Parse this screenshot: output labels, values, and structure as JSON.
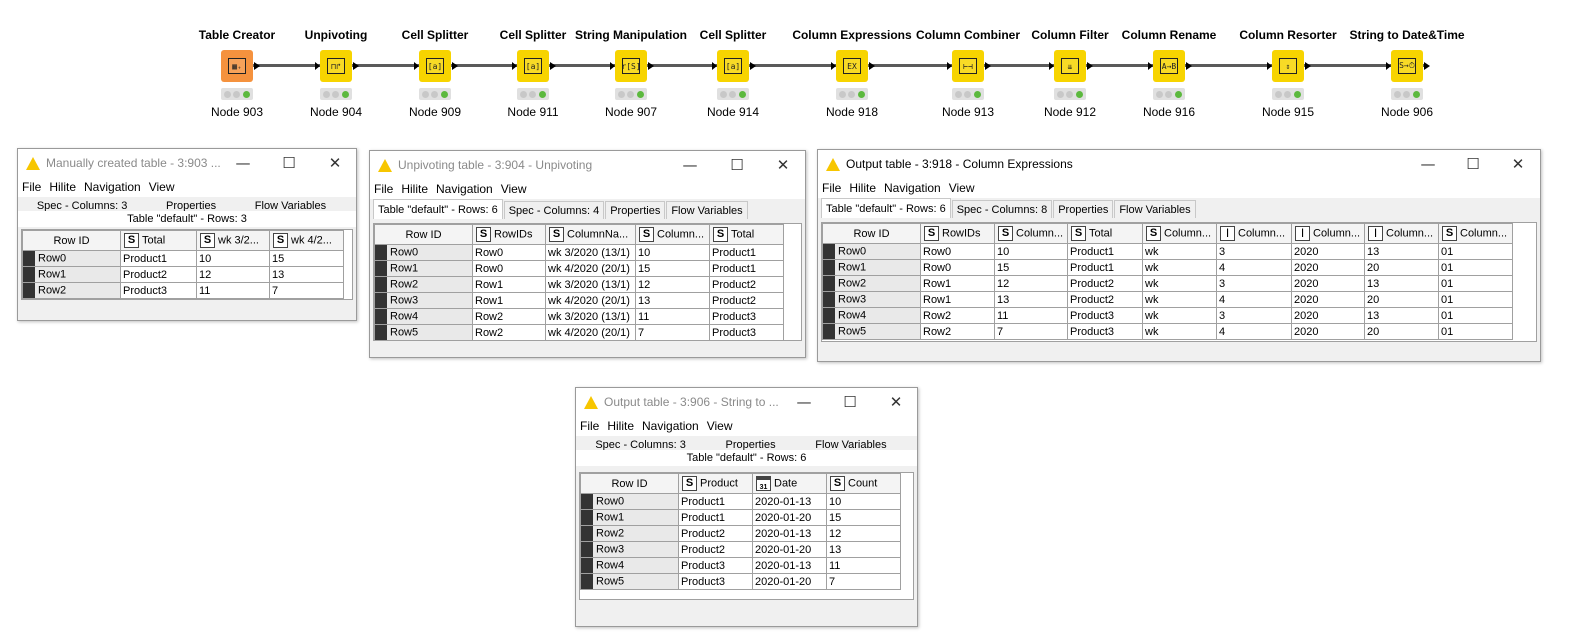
{
  "workflow": {
    "nodes": [
      {
        "name": "Table Creator",
        "label": "Node 903",
        "icon": "table-creator-icon",
        "glyph": "▦₊",
        "kind": "source"
      },
      {
        "name": "Unpivoting",
        "label": "Node 904",
        "icon": "unpivoting-icon",
        "glyph": "⊓↱",
        "kind": "manipulator"
      },
      {
        "name": "Cell Splitter",
        "label": "Node 909",
        "icon": "cell-splitter-icon",
        "glyph": "[a]",
        "kind": "manipulator"
      },
      {
        "name": "Cell Splitter",
        "label": "Node 911",
        "icon": "cell-splitter-icon",
        "glyph": "[a]",
        "kind": "manipulator"
      },
      {
        "name": "String Manipulation",
        "label": "Node 907",
        "icon": "string-manipulation-icon",
        "glyph": "r[S]",
        "kind": "manipulator"
      },
      {
        "name": "Cell Splitter",
        "label": "Node 914",
        "icon": "cell-splitter-icon",
        "glyph": "[a]",
        "kind": "manipulator"
      },
      {
        "name": "Column Expressions",
        "label": "Node 918",
        "icon": "column-expressions-icon",
        "glyph": "EX",
        "kind": "manipulator"
      },
      {
        "name": "Column Combiner",
        "label": "Node 913",
        "icon": "column-combiner-icon",
        "glyph": "⊢⊣",
        "kind": "manipulator"
      },
      {
        "name": "Column Filter",
        "label": "Node 912",
        "icon": "column-filter-icon",
        "glyph": "⇊",
        "kind": "manipulator"
      },
      {
        "name": "Column Rename",
        "label": "Node 916",
        "icon": "column-rename-icon",
        "glyph": "A→B",
        "kind": "manipulator"
      },
      {
        "name": "Column Resorter",
        "label": "Node 915",
        "icon": "column-resorter-icon",
        "glyph": "⇕",
        "kind": "manipulator"
      },
      {
        "name": "String to Date&Time",
        "label": "Node 906",
        "icon": "string-to-datetime-icon",
        "glyph": "S→⏱",
        "kind": "manipulator"
      }
    ]
  },
  "menu": [
    "File",
    "Hilite",
    "Navigation",
    "View"
  ],
  "win1": {
    "title": "Manually created table - 3:903 ...",
    "tabs": [
      "Spec - Columns: 3",
      "Properties",
      "Flow Variables"
    ],
    "caption": "Table \"default\" - Rows: 3",
    "headers": [
      {
        "t": "",
        "label": "Row ID"
      },
      {
        "t": "S",
        "label": "Total"
      },
      {
        "t": "S",
        "label": "wk 3/2..."
      },
      {
        "t": "S",
        "label": "wk 4/2..."
      }
    ],
    "rows": [
      [
        "Row0",
        "Product1",
        "10",
        "15"
      ],
      [
        "Row1",
        "Product2",
        "12",
        "13"
      ],
      [
        "Row2",
        "Product3",
        "11",
        "7"
      ]
    ]
  },
  "win2": {
    "title": "Unpivoting table - 3:904 - Unpivoting",
    "tabs": [
      "Table \"default\" - Rows: 6",
      "Spec - Columns: 4",
      "Properties",
      "Flow Variables"
    ],
    "headers": [
      {
        "t": "",
        "label": "Row ID"
      },
      {
        "t": "S",
        "label": "RowIDs"
      },
      {
        "t": "S",
        "label": "ColumnNa..."
      },
      {
        "t": "S",
        "label": "Column..."
      },
      {
        "t": "S",
        "label": "Total"
      }
    ],
    "rows": [
      [
        "Row0",
        "Row0",
        "wk 3/2020 (13/1)",
        "10",
        "Product1"
      ],
      [
        "Row1",
        "Row0",
        "wk 4/2020 (20/1)",
        "15",
        "Product1"
      ],
      [
        "Row2",
        "Row1",
        "wk 3/2020 (13/1)",
        "12",
        "Product2"
      ],
      [
        "Row3",
        "Row1",
        "wk 4/2020 (20/1)",
        "13",
        "Product2"
      ],
      [
        "Row4",
        "Row2",
        "wk 3/2020 (13/1)",
        "11",
        "Product3"
      ],
      [
        "Row5",
        "Row2",
        "wk 4/2020 (20/1)",
        "7",
        "Product3"
      ]
    ]
  },
  "win3": {
    "title": "Output table - 3:918 - Column Expressions",
    "tabs": [
      "Table \"default\" - Rows: 6",
      "Spec - Columns: 8",
      "Properties",
      "Flow Variables"
    ],
    "headers": [
      {
        "t": "",
        "label": "Row ID"
      },
      {
        "t": "S",
        "label": "RowIDs"
      },
      {
        "t": "S",
        "label": "Column..."
      },
      {
        "t": "S",
        "label": "Total"
      },
      {
        "t": "S",
        "label": "Column..."
      },
      {
        "t": "I",
        "label": "Column..."
      },
      {
        "t": "I",
        "label": "Column..."
      },
      {
        "t": "I",
        "label": "Column..."
      },
      {
        "t": "S",
        "label": "Column..."
      }
    ],
    "rows": [
      [
        "Row0",
        "Row0",
        "10",
        "Product1",
        "wk",
        "3",
        "2020",
        "13",
        "01"
      ],
      [
        "Row1",
        "Row0",
        "15",
        "Product1",
        "wk",
        "4",
        "2020",
        "20",
        "01"
      ],
      [
        "Row2",
        "Row1",
        "12",
        "Product2",
        "wk",
        "3",
        "2020",
        "13",
        "01"
      ],
      [
        "Row3",
        "Row1",
        "13",
        "Product2",
        "wk",
        "4",
        "2020",
        "20",
        "01"
      ],
      [
        "Row4",
        "Row2",
        "11",
        "Product3",
        "wk",
        "3",
        "2020",
        "13",
        "01"
      ],
      [
        "Row5",
        "Row2",
        "7",
        "Product3",
        "wk",
        "4",
        "2020",
        "20",
        "01"
      ]
    ]
  },
  "win4": {
    "title": "Output table - 3:906 - String to ...",
    "tabs": [
      "Spec - Columns: 3",
      "Properties",
      "Flow Variables"
    ],
    "caption": "Table \"default\" - Rows: 6",
    "headers": [
      {
        "t": "",
        "label": "Row ID"
      },
      {
        "t": "S",
        "label": "Product"
      },
      {
        "t": "D",
        "label": "Date"
      },
      {
        "t": "S",
        "label": "Count"
      }
    ],
    "rows": [
      [
        "Row0",
        "Product1",
        "2020-01-13",
        "10"
      ],
      [
        "Row1",
        "Product1",
        "2020-01-20",
        "15"
      ],
      [
        "Row2",
        "Product2",
        "2020-01-13",
        "12"
      ],
      [
        "Row3",
        "Product2",
        "2020-01-20",
        "13"
      ],
      [
        "Row4",
        "Product3",
        "2020-01-13",
        "11"
      ],
      [
        "Row5",
        "Product3",
        "2020-01-20",
        "7"
      ]
    ]
  },
  "window_controls": {
    "minimize": "—",
    "maximize": "☐",
    "close": "✕"
  }
}
